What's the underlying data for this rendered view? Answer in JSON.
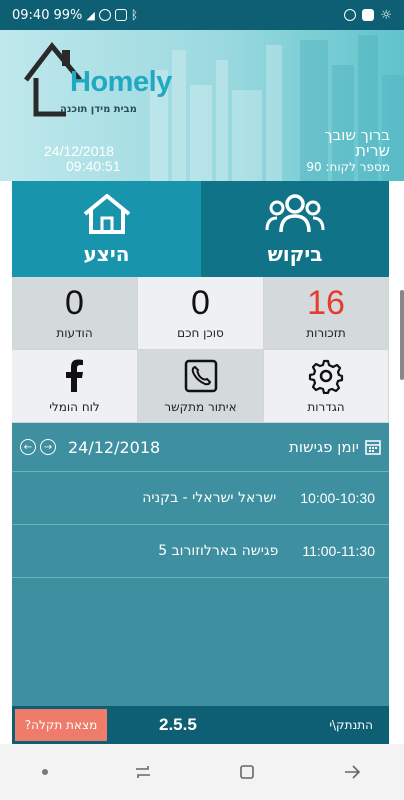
{
  "status_bar": {
    "time": "09:40",
    "battery": "99%"
  },
  "header": {
    "logo_title": "Homely",
    "logo_subtitle": "מבית מידן תוכנה",
    "date": "24/12/2018",
    "time": "09:40:51",
    "greeting": "ברוך שובך",
    "user_name": "שרית",
    "customer_number": "מספר לקוח: 90"
  },
  "tiles": {
    "demand_label": "ביקוש",
    "execute_label": "היצע"
  },
  "stats": {
    "reminders_count": "16",
    "reminders_label": "תזכורות",
    "smart_agent_count": "0",
    "smart_agent_label": "סוכן חכם",
    "messages_count": "0",
    "messages_label": "הודעות",
    "settings_label": "הגדרות",
    "caller_id_label": "איתור מתקשר",
    "homely_board_label": "לוח הומלי"
  },
  "diary": {
    "title": "יומן פגישות",
    "date": "24/12/2018",
    "meetings": [
      {
        "time": "10:00-10:30",
        "text": "ישראל ישראלי - בקניה"
      },
      {
        "time": "11:00-11:30",
        "text": "פגישה בארלוזורוב 5"
      }
    ]
  },
  "footer": {
    "report_label": "מצאת תקלה?",
    "version": "2.5.5",
    "logout_label": "התנתק\\י"
  },
  "colors": {
    "primary_dark": "#0e5f73",
    "primary": "#1895ad",
    "accent_red": "#e63b2e",
    "report_button": "#ef7b6a"
  }
}
